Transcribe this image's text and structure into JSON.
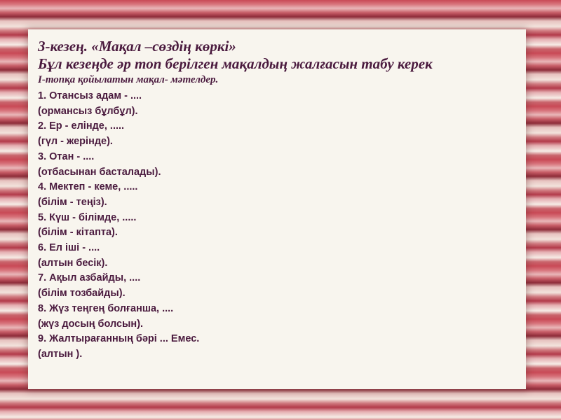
{
  "slide": {
    "title_line1": "3-кезең. «Мақал –сөздің көркі»",
    "title_line2": "Бұл кезеңде әр топ берілген мақалдың жалғасын табу керек",
    "subtitle": "І-топқа қойылатын мақал- мәтелдер.",
    "lines": [
      "1. Отансыз адам - ....",
      "(ормансыз бұлбұл).",
      "2. Ер - елінде, .....",
      "(гүл - жерінде).",
      "3. Отан - ....",
      "(отбасынан басталады).",
      "4. Мектеп - кеме, .....",
      "(білім - теңіз).",
      "5. Күш - білімде, .....",
      "(білім - кітапта).",
      "6. Ел іші - ....",
      "(алтын бесік).",
      "7. Ақыл азбайды, ....",
      "(білім тозбайды).",
      "8. Жүз теңгең болғанша, ....",
      "(жүз досың болсын).",
      "9. Жалтырағанның бәрі ... Емес.",
      "(алтын )."
    ]
  },
  "colors": {
    "text": "#4a1a3e",
    "panel": "#f8f5ee",
    "stripe_red": "#c94a56",
    "stripe_light": "#f2e3dc"
  }
}
